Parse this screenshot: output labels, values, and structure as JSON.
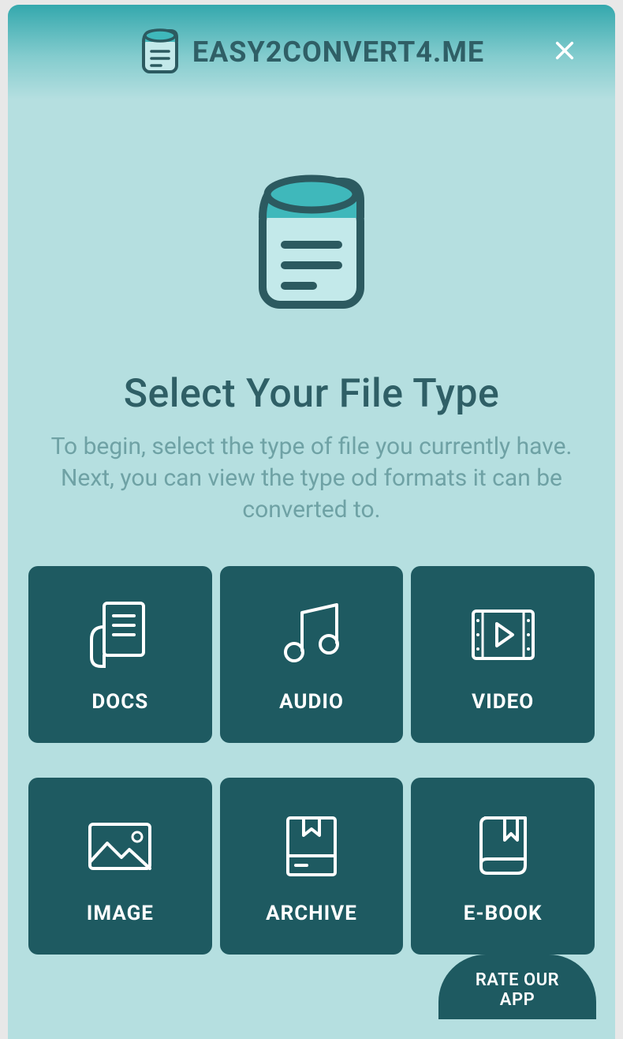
{
  "header": {
    "brand": "EASY2CONVERT4.ME"
  },
  "main": {
    "title": "Select Your File Type",
    "subtitle": "To begin, select the type of file you currently have. Next, you can view the type od formats it can be converted to."
  },
  "tiles": [
    {
      "label": "DOCS",
      "icon": "docs-icon"
    },
    {
      "label": "AUDIO",
      "icon": "audio-icon"
    },
    {
      "label": "VIDEO",
      "icon": "video-icon"
    },
    {
      "label": "IMAGE",
      "icon": "image-icon"
    },
    {
      "label": "ARCHIVE",
      "icon": "archive-icon"
    },
    {
      "label": "E-BOOK",
      "icon": "ebook-icon"
    }
  ],
  "footer": {
    "rate_label": "RATE OUR APP"
  }
}
